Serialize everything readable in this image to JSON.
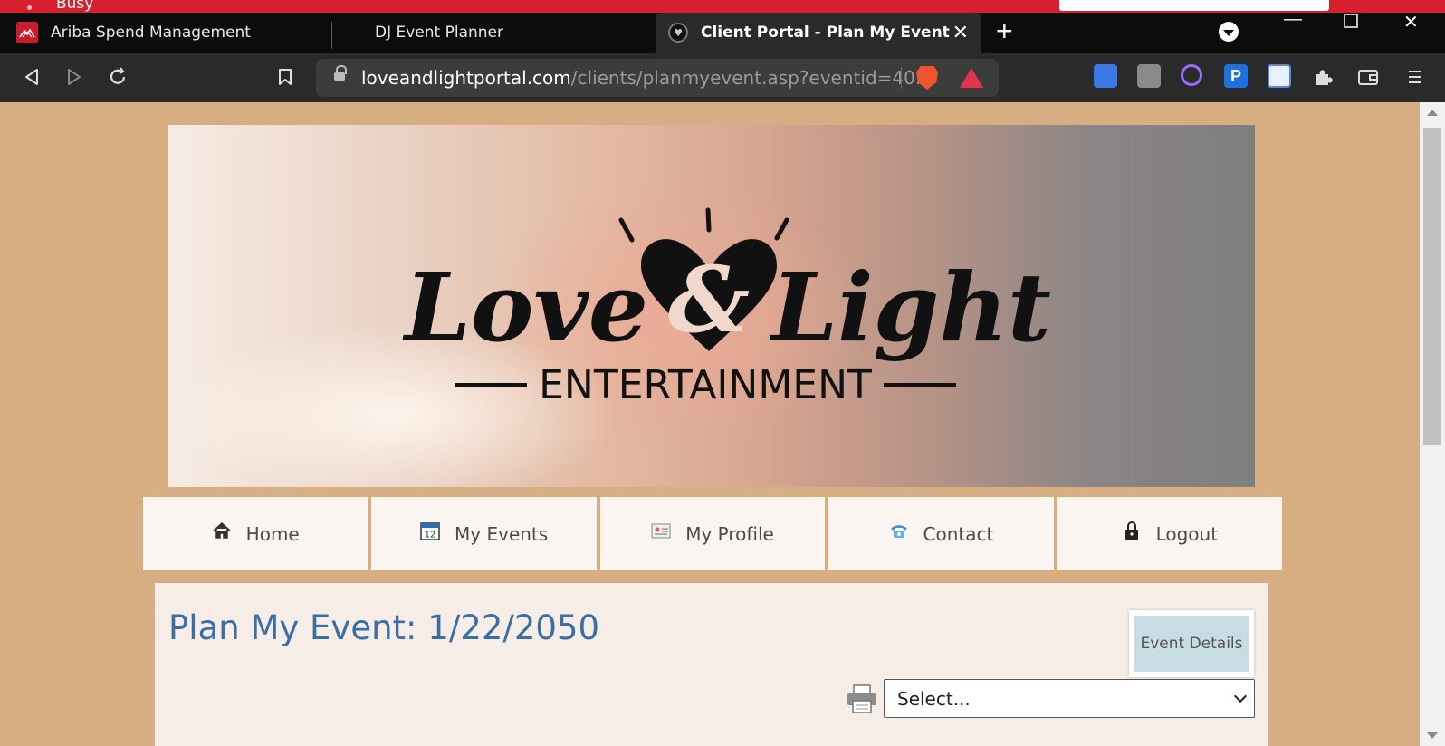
{
  "notification": {
    "text": "Busy"
  },
  "tabs": [
    {
      "label": "Ariba Spend Management",
      "active": false
    },
    {
      "label": "DJ Event Planner",
      "active": false
    },
    {
      "label": "Client Portal - Plan My Event",
      "active": true
    }
  ],
  "address_bar": {
    "host": "loveandlightportal.com",
    "path": "/clients/planmyevent.asp?eventid=40..."
  },
  "banner": {
    "logo_word_left": "Love",
    "logo_ampersand": "&",
    "logo_word_right": "Light",
    "logo_sub": "ENTERTAINMENT"
  },
  "nav": [
    {
      "label": "Home",
      "icon": "home-icon"
    },
    {
      "label": "My Events",
      "icon": "calendar-icon"
    },
    {
      "label": "My Profile",
      "icon": "id-card-icon"
    },
    {
      "label": "Contact",
      "icon": "telephone-icon"
    },
    {
      "label": "Logout",
      "icon": "lock-icon"
    }
  ],
  "content": {
    "title": "Plan My Event: 1/22/2050",
    "event_details_label": "Event Details",
    "select_value": "Select..."
  },
  "colors": {
    "page_bg": "#d6ae82",
    "title": "#3a6ea5",
    "event_details_bg": "#c7dde3"
  }
}
